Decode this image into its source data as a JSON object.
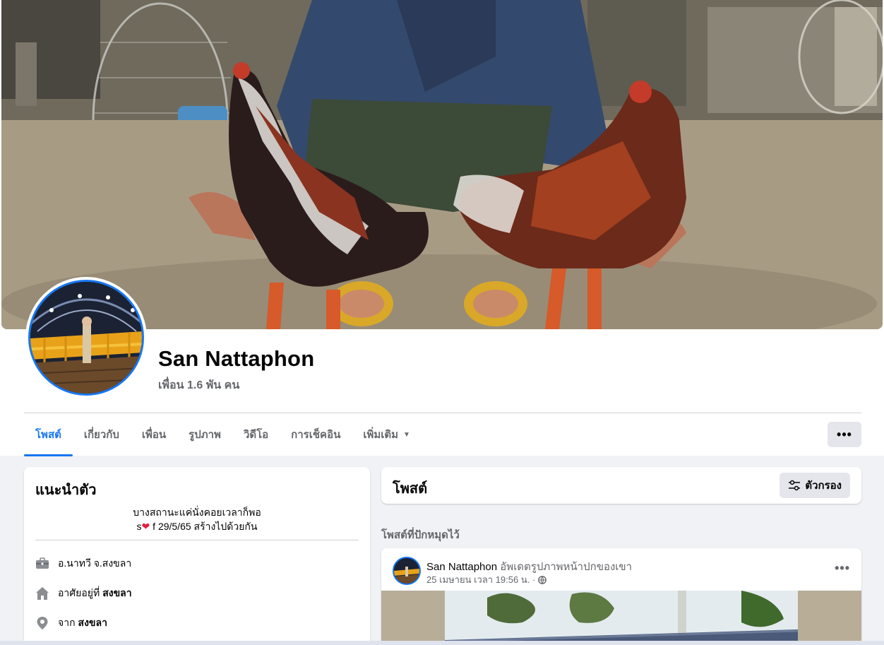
{
  "profile": {
    "name": "San Nattaphon",
    "friends": "เพื่อน 1.6 พัน คน"
  },
  "tabs": [
    {
      "label": "โพสต์",
      "active": true
    },
    {
      "label": "เกี่ยวกับ"
    },
    {
      "label": "เพื่อน"
    },
    {
      "label": "รูปภาพ"
    },
    {
      "label": "วิดีโอ"
    },
    {
      "label": "การเช็คอิน"
    },
    {
      "label": "เพิ่มเติม",
      "dropdown": true
    }
  ],
  "more_button": "•••",
  "intro": {
    "title": "แนะนำตัว",
    "bio_line1": "บางสถานะแค่นั่งคอยเวลาก็พอ",
    "bio_line2_prefix": "s",
    "bio_line2_suffix": " f 29/5/65 สร้างไปด้วยกัน",
    "heart": "❤",
    "work": "อ.นาทวี จ.สงขลา",
    "lives_prefix": "อาศัยอยู่ที่",
    "lives_city": "สงขลา",
    "from_prefix": "จาก",
    "from_city": "สงขลา"
  },
  "posts": {
    "title": "โพสต์",
    "filter_label": "ตัวกรอง",
    "pinned_label": "โพสต์ที่ปักหมุดไว้"
  },
  "pinned_post": {
    "author": "San Nattaphon",
    "action": "อัพเดตรูปภาพหน้าปกของเขา",
    "timestamp": "25 เมษายน เวลา 19:56 น. ·",
    "menu": "•••"
  },
  "icons": {
    "work": "briefcase-icon",
    "home": "home-icon",
    "location": "location-pin-icon",
    "filter": "filter-sliders-icon",
    "globe": "globe-icon"
  },
  "colors": {
    "accent": "#1877f2",
    "secondary_text": "#65676b",
    "background": "#f0f2f5"
  }
}
